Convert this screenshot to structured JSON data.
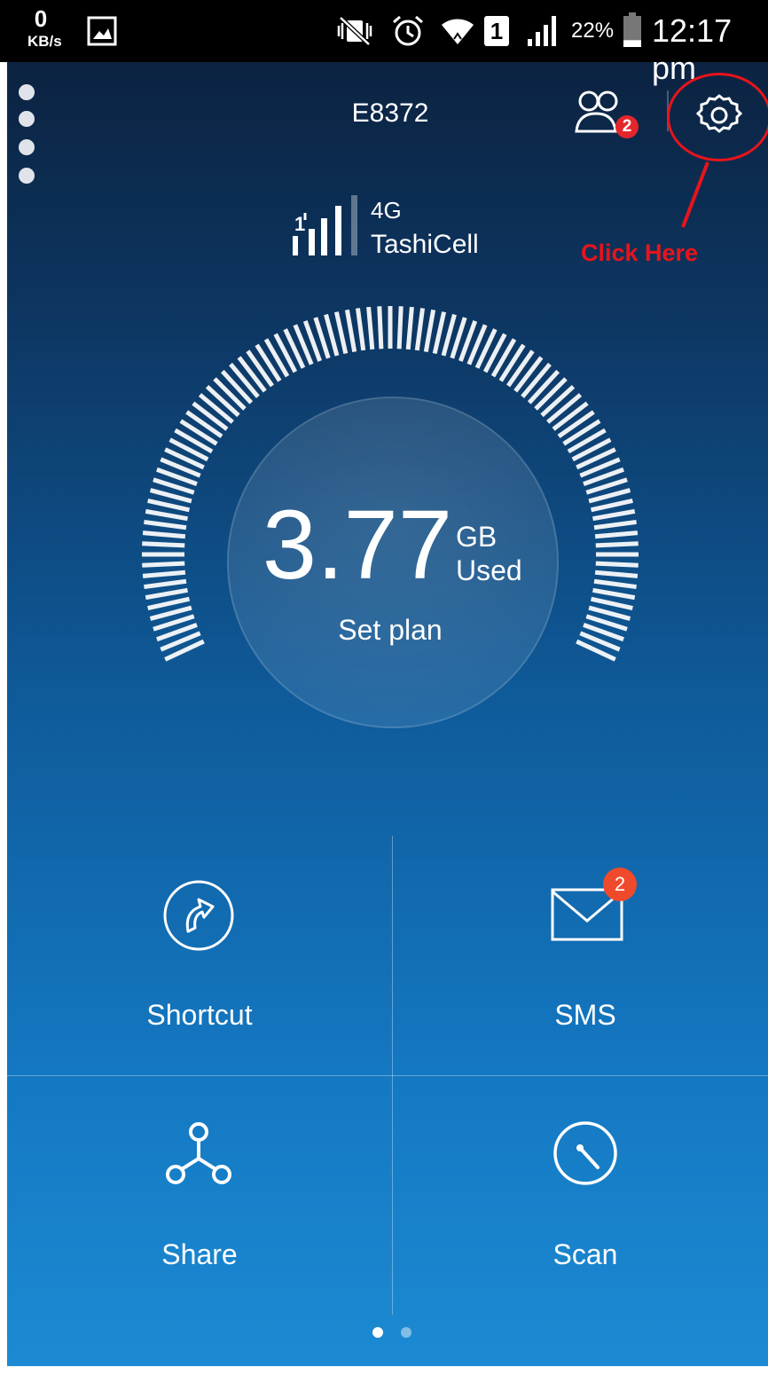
{
  "status_bar": {
    "net_speed_value": "0",
    "net_speed_unit": "KB/s",
    "sim_slot": "1",
    "battery_percent": "22%",
    "battery_level": 0.22,
    "time": "12:17 pm"
  },
  "header": {
    "device_name": "E8372",
    "users_badge": "2",
    "icons": [
      "more-dots-icon",
      "connected-users-icon",
      "settings-gear-icon"
    ]
  },
  "annotation": {
    "text": "Click Here",
    "color": "#e8141b"
  },
  "network": {
    "type": "4G",
    "carrier": "TashiCell"
  },
  "usage": {
    "value": "3.77",
    "unit": "GB",
    "label": "Used",
    "action": "Set plan"
  },
  "tiles": [
    {
      "label": "Shortcut",
      "icon": "shortcut-icon"
    },
    {
      "label": "SMS",
      "icon": "mail-icon",
      "badge": "2"
    },
    {
      "label": "Share",
      "icon": "share-nodes-icon"
    },
    {
      "label": "Scan",
      "icon": "scan-dial-icon"
    }
  ],
  "pager": {
    "pages": 2,
    "active": 0
  },
  "colors": {
    "accent_red": "#e8141b",
    "badge": "#f04a2c"
  }
}
